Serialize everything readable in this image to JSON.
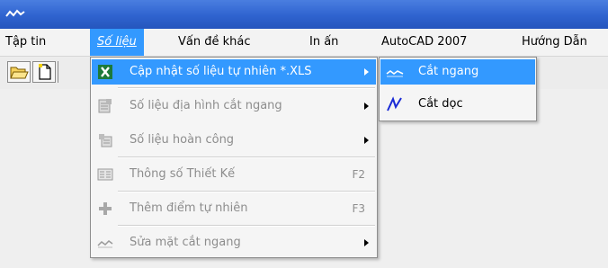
{
  "menubar": {
    "items": [
      {
        "label": "Tập tin"
      },
      {
        "label": "Số liệu"
      },
      {
        "label": "Vấn đề khác"
      },
      {
        "label": "In ấn"
      },
      {
        "label": "AutoCAD 2007"
      },
      {
        "label": "Hướng Dẫn"
      }
    ]
  },
  "toolbar": {
    "buttons": [
      {
        "icon": "open-folder-icon"
      },
      {
        "icon": "new-file-icon"
      }
    ]
  },
  "dropdown": {
    "items": [
      {
        "label": "Cập nhật số liệu tự nhiên *.XLS",
        "icon": "excel-icon",
        "shortcut": "",
        "submenu": true,
        "enabled": true,
        "highlighted": true
      },
      {
        "label": "Số liệu địa hình cắt ngang",
        "icon": "terrain-data-icon",
        "shortcut": "",
        "submenu": true,
        "enabled": false
      },
      {
        "label": "Số liệu hoàn công",
        "icon": "as-built-data-icon",
        "shortcut": "",
        "submenu": true,
        "enabled": false
      },
      {
        "label": "Thông số Thiết Kế",
        "icon": "design-params-icon",
        "shortcut": "F2",
        "submenu": false,
        "enabled": false
      },
      {
        "label": "Thêm điểm tự nhiên",
        "icon": "add-point-icon",
        "shortcut": "F3",
        "submenu": false,
        "enabled": false
      },
      {
        "label": "Sửa mặt cắt ngang",
        "icon": "edit-section-icon",
        "shortcut": "",
        "submenu": true,
        "enabled": false
      }
    ]
  },
  "submenu": {
    "items": [
      {
        "label": "Cắt ngang",
        "icon": "cross-section-icon",
        "highlighted": true
      },
      {
        "label": "Cắt dọc",
        "icon": "longitudinal-section-icon",
        "highlighted": false
      }
    ]
  },
  "colors": {
    "highlight": "#3399ff",
    "titlebar": "#2f63cf",
    "disabled_text": "#8d8d8d"
  }
}
